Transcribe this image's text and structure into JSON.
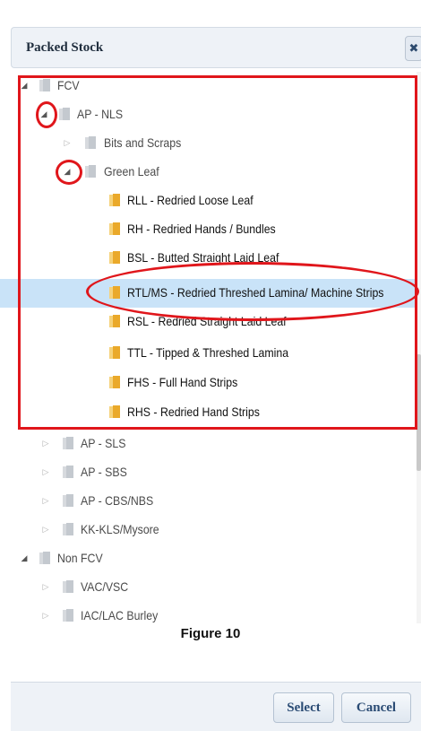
{
  "dialog": {
    "title": "Packed Stock",
    "close_label": "✖"
  },
  "tree": {
    "nodes": [
      {
        "label": "FCV",
        "state": "expanded"
      },
      {
        "label": "AP - NLS",
        "state": "expanded"
      },
      {
        "label": "Bits and Scraps",
        "state": "collapsed"
      },
      {
        "label": "Green Leaf",
        "state": "expanded"
      },
      {
        "label": "RLL - Redried Loose Leaf",
        "state": "leaf"
      },
      {
        "label": "RH - Redried Hands / Bundles",
        "state": "leaf"
      },
      {
        "label": "BSL - Butted Straight Laid Leaf",
        "state": "leaf"
      },
      {
        "label": "RTL/MS - Redried Threshed Lamina/ Machine Strips",
        "state": "leaf",
        "selected": true
      },
      {
        "label": "RSL - Redried Straight Laid Leaf",
        "state": "leaf"
      },
      {
        "label": "TTL - Tipped & Threshed Lamina",
        "state": "leaf"
      },
      {
        "label": "FHS - Full Hand Strips",
        "state": "leaf"
      },
      {
        "label": "RHS - Redried Hand Strips",
        "state": "leaf"
      },
      {
        "label": "AP - SLS",
        "state": "collapsed"
      },
      {
        "label": "AP - SBS",
        "state": "collapsed"
      },
      {
        "label": "AP - CBS/NBS",
        "state": "collapsed"
      },
      {
        "label": "KK-KLS/Mysore",
        "state": "collapsed"
      },
      {
        "label": "Non FCV",
        "state": "expanded"
      },
      {
        "label": "VAC/VSC",
        "state": "collapsed"
      },
      {
        "label": "IAC/LAC Burley",
        "state": "collapsed"
      }
    ]
  },
  "caption": "Figure 10",
  "footer": {
    "select_label": "Select",
    "cancel_label": "Cancel"
  },
  "colors": {
    "highlight": "#e0161b",
    "selected_row": "#c9e3f8",
    "folder_closed": "#cfd3d8",
    "folder_open": "#f2b63c"
  }
}
